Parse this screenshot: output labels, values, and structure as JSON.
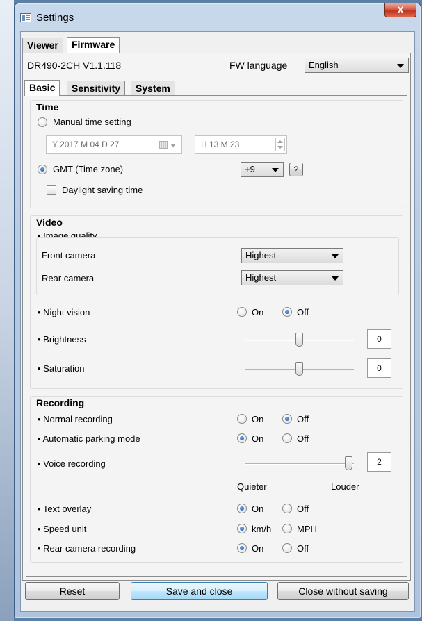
{
  "window": {
    "title": "Settings",
    "close_glyph": "X"
  },
  "tabs": {
    "viewer": "Viewer",
    "firmware": "Firmware"
  },
  "firmware": {
    "model": "DR490-2CH   V1.1.118",
    "language_label": "FW language",
    "language_value": "English"
  },
  "subtabs": {
    "basic": "Basic",
    "sensitivity": "Sensitivity",
    "system": "System"
  },
  "time": {
    "title": "Time",
    "manual_label": "Manual time setting",
    "date_value": "Y 2017 M 04 D 27",
    "time_value": "H 13 M 23",
    "gmt_label": "GMT (Time zone)",
    "gmt_value": "+9",
    "help_label": "?",
    "dst_label": "Daylight saving time",
    "selected_mode": "gmt"
  },
  "video": {
    "title": "Video",
    "image_quality_label": "• Image quality",
    "front_label": "Front camera",
    "front_value": "Highest",
    "rear_label": "Rear camera",
    "rear_value": "Highest",
    "night_label": "• Night vision",
    "night_value": "Off",
    "brightness_label": "• Brightness",
    "brightness_value": "0",
    "saturation_label": "• Saturation",
    "saturation_value": "0",
    "on_label": "On",
    "off_label": "Off"
  },
  "recording": {
    "title": "Recording",
    "normal_label": "• Normal recording",
    "normal_value": "Off",
    "parking_label": "• Automatic parking mode",
    "parking_value": "On",
    "voice_label": "• Voice recording",
    "voice_value": "2",
    "quieter_label": "Quieter",
    "louder_label": "Louder",
    "overlay_label": "• Text overlay",
    "overlay_value": "On",
    "speed_label": "• Speed unit",
    "speed_value": "km/h",
    "speed_kmh": "km/h",
    "speed_mph": "MPH",
    "rear_rec_label": "• Rear camera recording",
    "rear_rec_value": "On",
    "on_label": "On",
    "off_label": "Off"
  },
  "buttons": {
    "reset": "Reset",
    "save": "Save and close",
    "close": "Close without saving"
  },
  "icons": [
    "app-icon",
    "close-icon",
    "calendar-icon",
    "dropdown-arrow-icon",
    "spinner-icon"
  ]
}
